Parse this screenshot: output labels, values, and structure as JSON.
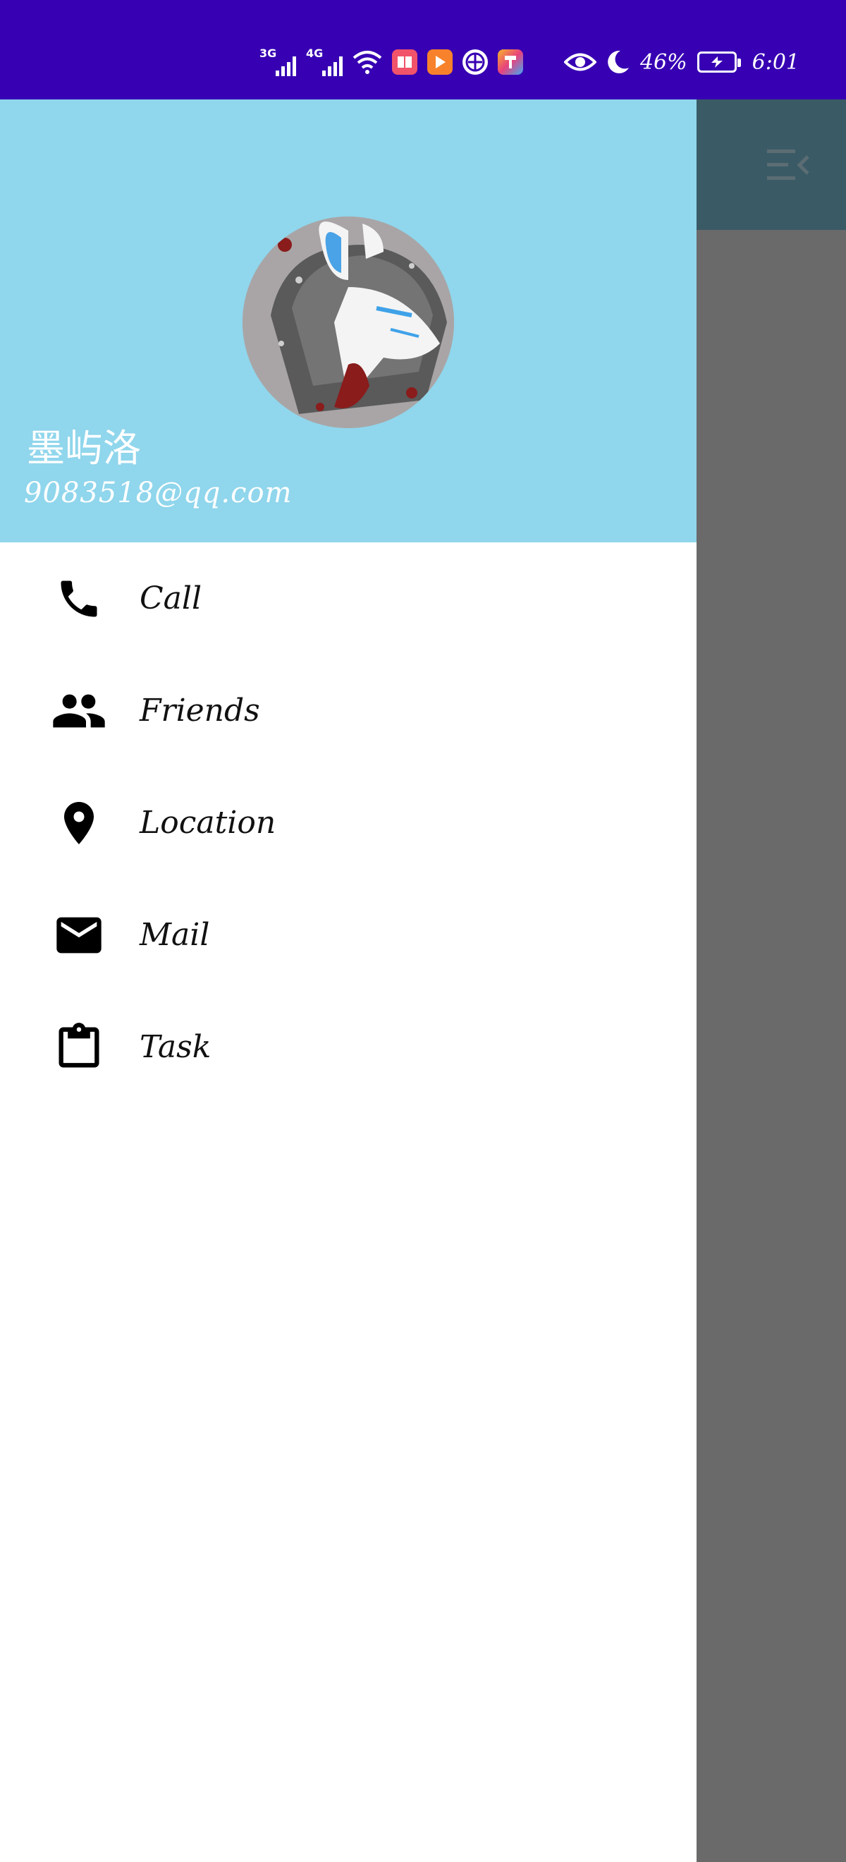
{
  "status_bar": {
    "network_1": "3G",
    "network_2": "4G",
    "battery_percent": "46%",
    "time": "6:01"
  },
  "drawer": {
    "header": {
      "user_name": "墨屿洛",
      "user_email": "9083518@qq.com",
      "avatar_icon": "wolf-avatar-icon"
    },
    "menu": [
      {
        "label": "Call",
        "icon": "phone-icon"
      },
      {
        "label": "Friends",
        "icon": "people-icon"
      },
      {
        "label": "Location",
        "icon": "location-pin-icon"
      },
      {
        "label": "Mail",
        "icon": "mail-icon"
      },
      {
        "label": "Task",
        "icon": "clipboard-icon"
      }
    ]
  },
  "colors": {
    "status_bar": "#3700b3",
    "drawer_header": "#90d6ec",
    "scrim": "#6a6a6a",
    "toolbar_dimmed": "#3a5a66"
  }
}
